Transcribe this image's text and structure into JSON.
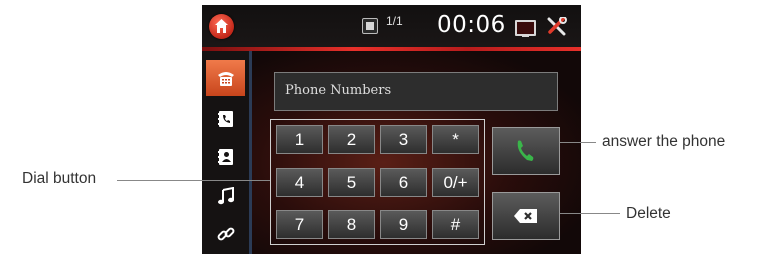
{
  "status_bar": {
    "page_indicator": "1/1",
    "clock": "00:06"
  },
  "sidebar": {
    "items": [
      {
        "name": "dialpad",
        "icon": "dialpad-icon",
        "active": true
      },
      {
        "name": "call-log",
        "icon": "call-log-icon",
        "active": false
      },
      {
        "name": "contacts",
        "icon": "contacts-icon",
        "active": false
      },
      {
        "name": "music",
        "icon": "music-note-icon",
        "active": false
      },
      {
        "name": "link",
        "icon": "link-icon",
        "active": false
      }
    ]
  },
  "main": {
    "number_field": {
      "placeholder": "Phone Numbers"
    },
    "keypad": {
      "keys": [
        "1",
        "2",
        "3",
        "*",
        "4",
        "5",
        "6",
        "0/+",
        "7",
        "8",
        "9",
        "#"
      ]
    }
  },
  "callouts": {
    "dial_button": "Dial button",
    "answer": "answer the phone",
    "delete": "Delete"
  },
  "colors": {
    "accent_red": "#e8302a",
    "active_tab": "#e8692f",
    "call_green": "#3ab54a"
  }
}
